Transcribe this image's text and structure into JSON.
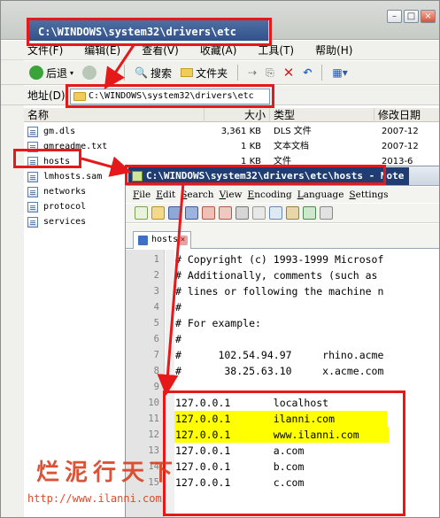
{
  "explorer": {
    "title": "C:\\WINDOWS\\system32\\drivers\\etc",
    "menu": [
      "文件(F)",
      "编辑(E)",
      "查看(V)",
      "收藏(A)",
      "工具(T)",
      "帮助(H)"
    ],
    "toolbar": {
      "back": "后退",
      "search": "搜索",
      "folders": "文件夹"
    },
    "address_label": "地址(D)",
    "address_value": "C:\\WINDOWS\\system32\\drivers\\etc",
    "columns": {
      "name": "名称",
      "size": "大小",
      "type": "类型",
      "modified": "修改日期"
    },
    "files": [
      {
        "name": "gm.dls",
        "size": "3,361 KB",
        "type": "DLS 文件",
        "date": "2007-12"
      },
      {
        "name": "gmreadme.txt",
        "size": "1 KB",
        "type": "文本文档",
        "date": "2007-12"
      },
      {
        "name": "hosts",
        "size": "1 KB",
        "type": "文件",
        "date": "2013-6"
      },
      {
        "name": "lmhosts.sam",
        "size": "",
        "type": "",
        "date": ""
      },
      {
        "name": "networks",
        "size": "",
        "type": "",
        "date": ""
      },
      {
        "name": "protocol",
        "size": "",
        "type": "",
        "date": ""
      },
      {
        "name": "services",
        "size": "",
        "type": "",
        "date": ""
      }
    ]
  },
  "notepad": {
    "title": "C:\\WINDOWS\\system32\\drivers\\etc\\hosts - Note",
    "menu": [
      "File",
      "Edit",
      "Search",
      "View",
      "Encoding",
      "Language",
      "Settings"
    ],
    "tab_label": "hosts",
    "lines": [
      {
        "n": "1",
        "text": "# Copyright (c) 1993-1999 Microsof"
      },
      {
        "n": "2",
        "text": "# Additionally, comments (such as "
      },
      {
        "n": "3",
        "text": "# lines or following the machine n"
      },
      {
        "n": "4",
        "text": "#"
      },
      {
        "n": "5",
        "text": "# For example:"
      },
      {
        "n": "6",
        "text": "#"
      },
      {
        "n": "7",
        "text": "#      102.54.94.97     rhino.acme"
      },
      {
        "n": "8",
        "text": "#       38.25.63.10     x.acme.com"
      },
      {
        "n": "9",
        "text": ""
      },
      {
        "n": "10",
        "text": "127.0.0.1       localhost"
      },
      {
        "n": "11",
        "text": "127.0.0.1       ilanni.com"
      },
      {
        "n": "12",
        "text": "127.0.0.1       www.ilanni.com"
      },
      {
        "n": "13",
        "text": "127.0.0.1       a.com"
      },
      {
        "n": "14",
        "text": "127.0.0.1       b.com"
      },
      {
        "n": "15",
        "text": "127.0.0.1       c.com"
      }
    ]
  },
  "watermark": {
    "brand": "烂泥行天下",
    "url": "http://www.ilanni.com"
  },
  "colors": {
    "annotation": "#e51919",
    "highlight": "#ffff00",
    "title_blue": "#1f3c73"
  }
}
